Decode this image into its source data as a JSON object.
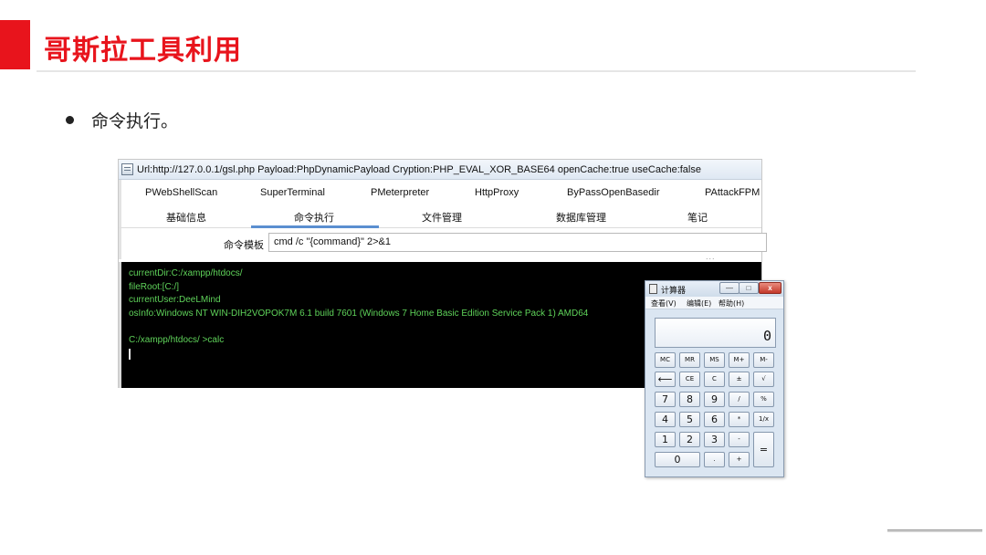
{
  "slide": {
    "title": "哥斯拉工具利用",
    "bullet": "命令执行。",
    "accent_color": "#e8141c"
  },
  "tool_window": {
    "title": "Url:http://127.0.0.1/gsl.php Payload:PhpDynamicPayload Cryption:PHP_EVAL_XOR_BASE64 openCache:true useCache:false",
    "plugin_tabs": [
      "PWebShellScan",
      "SuperTerminal",
      "PMeterpreter",
      "HttpProxy",
      "ByPassOpenBasedir",
      "PAttackFPM"
    ],
    "main_tabs": [
      "基础信息",
      "命令执行",
      "文件管理",
      "数据库管理",
      "笔记"
    ],
    "active_main_tab": "命令执行",
    "command_template_label": "命令模板",
    "command_template_value": "cmd /c \"{command}\" 2>&1",
    "more_indicator": "...",
    "terminal_lines": [
      "currentDir:C:/xampp/htdocs/",
      "fileRoot:[C:/]",
      "currentUser:DeeLMind",
      "osInfo:Windows NT WIN-DIH2VOPOK7M 6.1 build 7601 (Windows 7 Home Basic Edition Service Pack 1) AMD64",
      "C:/xampp/htdocs/ >calc"
    ],
    "terminal_text_color": "#5fd35a"
  },
  "calculator": {
    "title": "计算器",
    "menu": [
      "查看(V)",
      "编辑(E)",
      "帮助(H)"
    ],
    "display": "0",
    "window_buttons": {
      "minimize": "—",
      "maximize": "□",
      "close": "x"
    },
    "buttons": {
      "mc": "MC",
      "mr": "MR",
      "ms": "MS",
      "mplus": "M+",
      "mminus": "M-",
      "back": "⟵",
      "ce": "CE",
      "c": "C",
      "sign": "±",
      "sqrt": "√",
      "n7": "7",
      "n8": "8",
      "n9": "9",
      "divide": "/",
      "percent": "%",
      "n4": "4",
      "n5": "5",
      "n6": "6",
      "multiply": "*",
      "reciprocal": "1/x",
      "n1": "1",
      "n2": "2",
      "n3": "3",
      "minus": "-",
      "equals": "=",
      "n0": "0",
      "dot": ".",
      "plus": "+"
    }
  }
}
